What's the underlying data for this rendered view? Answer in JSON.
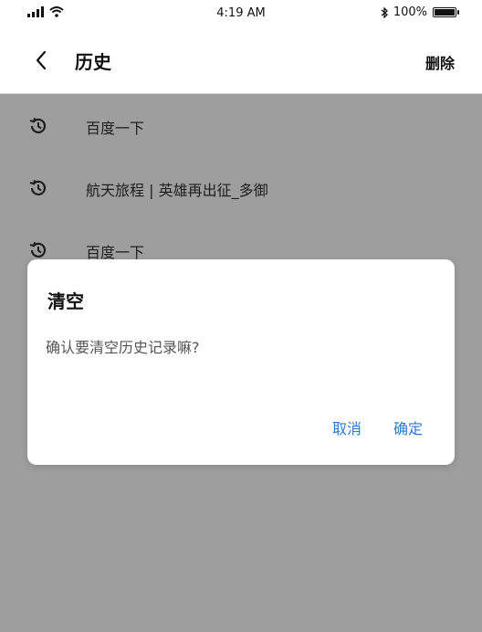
{
  "status_bar": {
    "time": "4:19 AM",
    "battery_text": "100%",
    "battery_level": 1.0,
    "icons": [
      "signal-icon",
      "wifi-icon",
      "bluetooth-icon",
      "battery-icon"
    ]
  },
  "header": {
    "title": "历史",
    "delete_label": "删除",
    "back_icon": "chevron-left-icon"
  },
  "history": {
    "icon": "history-icon",
    "items": [
      {
        "label": "百度一下"
      },
      {
        "label": "航天旅程 | 英雄再出征_多御"
      },
      {
        "label": "百度一下"
      }
    ]
  },
  "dialog": {
    "title": "清空",
    "message": "确认要清空历史记录嘛?",
    "cancel_label": "取消",
    "confirm_label": "确定"
  },
  "colors": {
    "overlay": "#9e9e9e",
    "accent": "#2c79d3"
  }
}
